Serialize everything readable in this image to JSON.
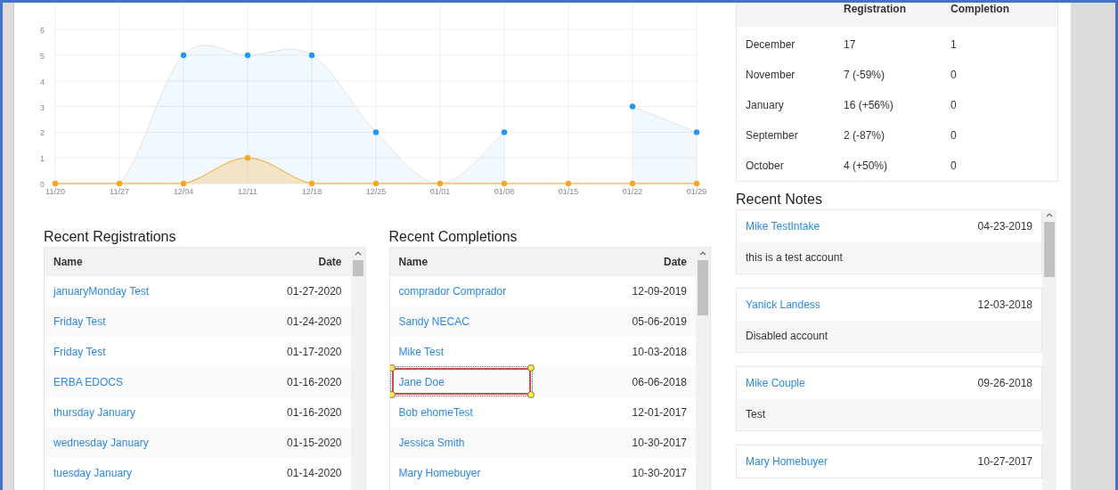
{
  "activity_chart": {
    "chart_data": {
      "type": "area",
      "categories": [
        "11/20",
        "11/27",
        "12/04",
        "12/11",
        "12/18",
        "12/25",
        "01/01",
        "01/08",
        "01/15",
        "01/22",
        "01/29"
      ],
      "series": [
        {
          "color": "#2196f3",
          "values": [
            0,
            0,
            5,
            5,
            5,
            2,
            0,
            2,
            null,
            3,
            2
          ]
        },
        {
          "color": "#f5a623",
          "values": [
            0,
            0,
            0,
            1,
            0,
            0,
            0,
            0,
            0,
            0,
            0
          ]
        }
      ],
      "ylim": [
        0,
        7.15
      ],
      "yticks": [
        0,
        1,
        2,
        3,
        4,
        5,
        6
      ],
      "grid": true
    }
  },
  "recent_registrations": {
    "title": "Recent Registrations",
    "columns": [
      "Name",
      "Date"
    ],
    "rows": [
      {
        "name": "januaryMonday Test",
        "date": "01-27-2020"
      },
      {
        "name": "Friday Test",
        "date": "01-24-2020"
      },
      {
        "name": "Friday Test",
        "date": "01-17-2020"
      },
      {
        "name": "ERBA EDOCS",
        "date": "01-16-2020"
      },
      {
        "name": "thursday January",
        "date": "01-16-2020"
      },
      {
        "name": "wednesday January",
        "date": "01-15-2020"
      },
      {
        "name": "tuesday January",
        "date": "01-14-2020"
      }
    ]
  },
  "recent_completions": {
    "title": "Recent Completions",
    "columns": [
      "Name",
      "Date"
    ],
    "rows": [
      {
        "name": "comprador Comprador",
        "date": "12-09-2019",
        "highlighted": false
      },
      {
        "name": "Sandy NECAC",
        "date": "05-06-2019",
        "highlighted": false
      },
      {
        "name": "Mike Test",
        "date": "10-03-2018",
        "highlighted": false
      },
      {
        "name": "Jane Doe",
        "date": "06-06-2018",
        "highlighted": true
      },
      {
        "name": "Bob ehomeTest",
        "date": "12-01-2017",
        "highlighted": false
      },
      {
        "name": "Jessica Smith",
        "date": "10-30-2017",
        "highlighted": false
      },
      {
        "name": "Mary Homebuyer",
        "date": "10-30-2017",
        "highlighted": false
      }
    ]
  },
  "monthly_stats": {
    "columns": [
      "Registration",
      "Completion"
    ],
    "rows": [
      {
        "month": "December",
        "registration": "17",
        "completion": "1"
      },
      {
        "month": "November",
        "registration": "7 (-59%)",
        "completion": "0"
      },
      {
        "month": "January",
        "registration": "16 (+56%)",
        "completion": "0"
      },
      {
        "month": "September",
        "registration": "2 (-87%)",
        "completion": "0"
      },
      {
        "month": "October",
        "registration": "4 (+50%)",
        "completion": "0"
      }
    ]
  },
  "recent_notes": {
    "title": "Recent Notes",
    "notes": [
      {
        "name": "Mike TestIntake",
        "date": "04-23-2019",
        "text": "this is a test account"
      },
      {
        "name": "Yanick Landess",
        "date": "12-03-2018",
        "text": "Disabled account"
      },
      {
        "name": "Mike Couple",
        "date": "09-26-2018",
        "text": "Test"
      },
      {
        "name": "Mary Homebuyer",
        "date": "10-27-2017"
      }
    ]
  }
}
